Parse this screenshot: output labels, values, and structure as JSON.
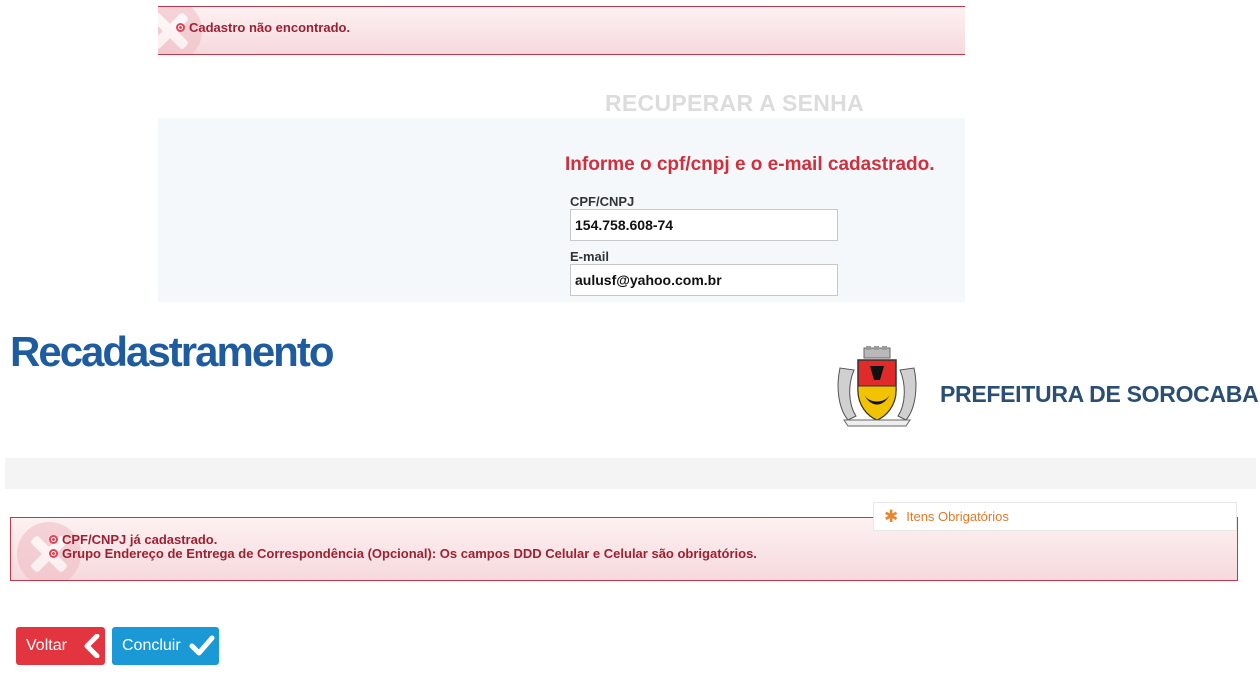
{
  "top_error": {
    "message": "Cadastro não encontrado."
  },
  "recover": {
    "title": "RECUPERAR A SENHA",
    "instruction": "Informe o cpf/cnpj e o e-mail cadastrado.",
    "cpf_label": "CPF/CNPJ",
    "cpf_value": "154.758.608-74",
    "email_label": "E-mail",
    "email_value": "aulusf@yahoo.com.br"
  },
  "header": {
    "logo_text": "Recadastramento",
    "municipality": "PREFEITURA DE SOROCABA",
    "crest_icon": "city-coat-of-arms-icon"
  },
  "required": {
    "label": "Itens Obrigatórios",
    "icon": "asterisk-icon"
  },
  "errors": [
    "CPF/CNPJ já cadastrado.",
    "Grupo Endereço de Entrega de Correspondência (Opcional): Os campos DDD Celular e Celular são obrigatórios."
  ],
  "buttons": {
    "back_label": "Voltar",
    "done_label": "Concluir"
  },
  "colors": {
    "error_border": "#c0394b",
    "error_text": "#9c2133",
    "instruction": "#d0303d",
    "back_button": "#e2353f",
    "done_button": "#1a99d6",
    "logo": "#1f5c9f"
  }
}
